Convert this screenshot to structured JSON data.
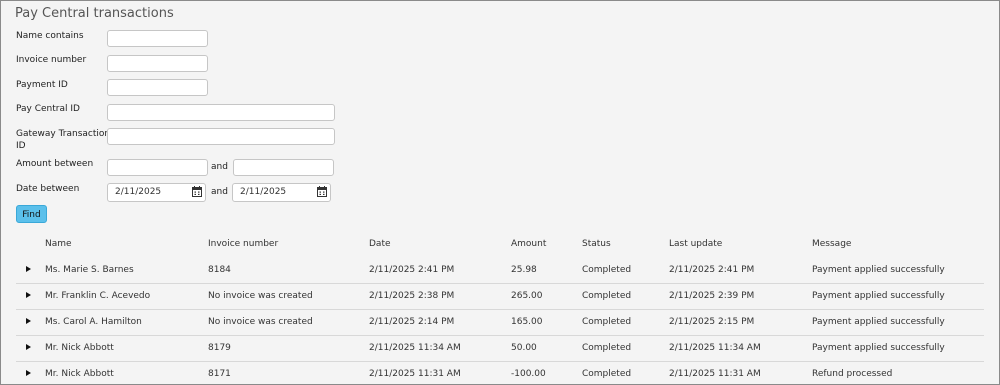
{
  "page": {
    "title": "Pay Central transactions"
  },
  "form": {
    "name_contains": {
      "label": "Name contains",
      "value": ""
    },
    "invoice_number": {
      "label": "Invoice number",
      "value": ""
    },
    "payment_id": {
      "label": "Payment ID",
      "value": ""
    },
    "pay_central_id": {
      "label": "Pay Central ID",
      "value": ""
    },
    "gateway_transaction_id": {
      "label_line1": "Gateway Transaction",
      "label_line2": "ID",
      "value": ""
    },
    "amount_between": {
      "label": "Amount between",
      "and": "and",
      "from": "",
      "to": ""
    },
    "date_between": {
      "label": "Date between",
      "and": "and",
      "from": "2/11/2025",
      "to": "2/11/2025"
    },
    "find_label": "Find"
  },
  "table": {
    "headers": [
      "Name",
      "Invoice number",
      "Date",
      "Amount",
      "Status",
      "Last update",
      "Message"
    ],
    "rows": [
      [
        "Ms. Marie S. Barnes",
        "8184",
        "2/11/2025 2:41 PM",
        "25.98",
        "Completed",
        "2/11/2025 2:41 PM",
        "Payment applied successfully"
      ],
      [
        "Mr. Franklin C. Acevedo",
        "No invoice was created",
        "2/11/2025 2:38 PM",
        "265.00",
        "Completed",
        "2/11/2025 2:39 PM",
        "Payment applied successfully"
      ],
      [
        "Ms. Carol A. Hamilton",
        "No invoice was created",
        "2/11/2025 2:14 PM",
        "165.00",
        "Completed",
        "2/11/2025 2:15 PM",
        "Payment applied successfully"
      ],
      [
        "Mr. Nick Abbott",
        "8179",
        "2/11/2025 11:34 AM",
        "50.00",
        "Completed",
        "2/11/2025 11:34 AM",
        "Payment applied successfully"
      ],
      [
        "Mr. Nick Abbott",
        "8171",
        "2/11/2025 11:31 AM",
        "-100.00",
        "Completed",
        "2/11/2025 11:31 AM",
        "Refund processed"
      ]
    ]
  }
}
